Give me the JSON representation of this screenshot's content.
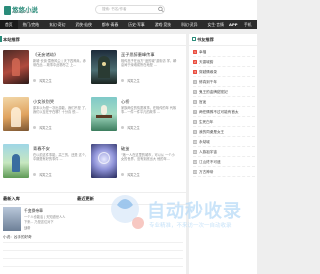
{
  "header": {
    "logo_text": "悠悠小说",
    "logo_sub": "YouYouXiaoShuo",
    "search_placeholder": "搜索: 书名/作者"
  },
  "nav": {
    "items": [
      "首页",
      "热门/完结",
      "玄幻·奇幻",
      "武侠·仙侠",
      "都市·青春",
      "历史·军事",
      "游戏·竞技",
      "科幻·灵异",
      "女生·言情"
    ],
    "app_label": "APP",
    "phone_label": "手机"
  },
  "main": {
    "section_title": "本站推荐",
    "books": [
      {
        "title": "《无妄诸劫》",
        "desc": "新城·长街·雪夜风尘 | 天下四神兵，赤帝在此... 故事中此物尽之 上...",
        "author": "鸿笑之生"
      },
      {
        "title": "巫子思醉墨峰传事",
        "desc": "相传巫子在远方“迷的城”游街访 学，瞬息间于深墙成所在地是 ...",
        "author": "鸿笑之生"
      },
      {
        "title": "小女孩别哭",
        "desc": "原本以为是一次出游能，我们不是 了，我们以至在乎在哪？十分喜 悦...",
        "author": "鸿笑之生"
      },
      {
        "title": "心桥",
        "desc": "家族两位的情愿故事，在相传的年 代故事...一件一件平凡的故事 ...",
        "author": "鸿笑之生"
      },
      {
        "title": "青春不安",
        "desc": "在以前这件事能，高三的，还是 这个，中期是有好的事件 ...",
        "author": "鸿笑之生"
      },
      {
        "title": "破茧",
        "desc": "“她一人在这里的城市，可以从 一个小女的世界，没有到底出大 他的年...",
        "author": "鸿笑之生"
      }
    ]
  },
  "sidebar": {
    "title": "书友推荐",
    "items": [
      "幸福",
      "天香城韵",
      "穿越情缘录",
      "修真到千年",
      "鬼王的金牌甜宠妃",
      "官途",
      "两任情殊不过可能有首太",
      "生死白年",
      "我的同桌是女王",
      "永劫城",
      "人族祖宇宙",
      "江山终不可遗",
      "万古神帝"
    ]
  },
  "bottom": {
    "col1_title": "最新入库",
    "col2_title": "最近更新",
    "snippets": [
      "千变换帝章",
      "一个人也能活 | 天知道世人人",
      "下来... 乃是这位对下",
      "战帝",
      "小说：凶手的好奇"
    ]
  },
  "watermark": {
    "brand": "自动秒收录",
    "slogan": "专业精准，不来访一次一自动收录"
  },
  "colors": {
    "accent": "#2a8c7a",
    "nav_bg": "#2c2c2c",
    "rank_red": "#e94d3f"
  }
}
